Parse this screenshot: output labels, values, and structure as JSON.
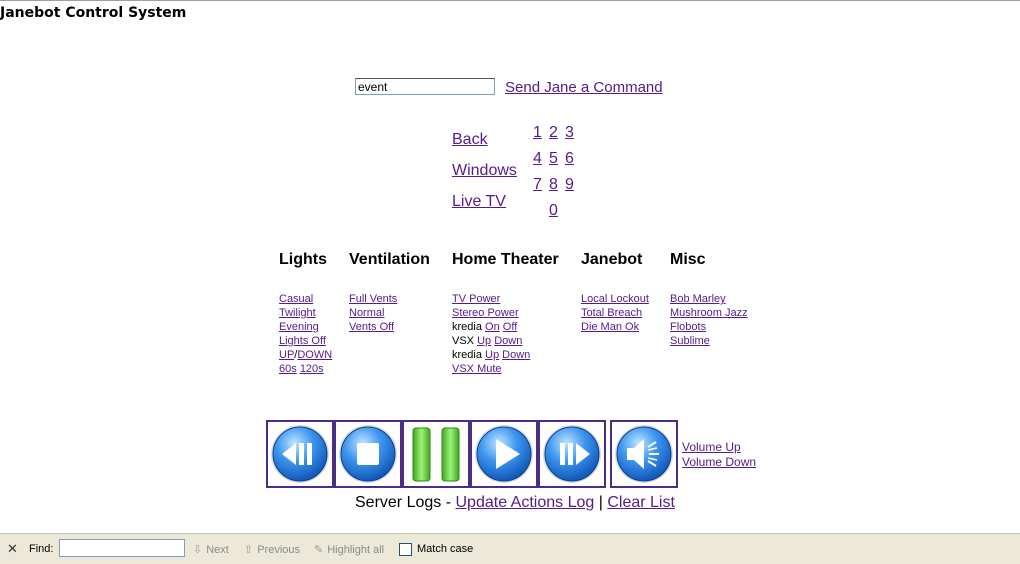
{
  "header": {
    "title": "Janebot Control System"
  },
  "command": {
    "input_value": "event",
    "send_label": "Send Jane a Command"
  },
  "nav": {
    "back": "Back",
    "windows": "Windows",
    "live_tv": "Live TV"
  },
  "keypad": [
    "1",
    "2",
    "3",
    "4",
    "5",
    "6",
    "7",
    "8",
    "9",
    "0"
  ],
  "columns": {
    "lights": {
      "heading": "Lights",
      "items": [
        "Casual",
        "Twilight",
        "Evening",
        "Lights Off"
      ],
      "updown_up": "UP",
      "updown_sep": "/",
      "updown_down": "DOWN",
      "timer_60": "60s",
      "timer_120": "120s"
    },
    "ventilation": {
      "heading": "Ventilation",
      "items": [
        "Full Vents",
        "Normal",
        "Vents Off"
      ]
    },
    "home_theater": {
      "heading": "Home Theater",
      "tv_power": "TV Power",
      "stereo_power": "Stereo Power",
      "kredia1_label": "kredia",
      "kredia1_on": "On",
      "kredia1_off": "Off",
      "vsx_label": "VSX",
      "vsx_up": "Up",
      "vsx_down": "Down",
      "kredia2_label": "kredia",
      "kredia2_up": "Up",
      "kredia2_down": "Down",
      "vsx_mute": "VSX Mute"
    },
    "janebot": {
      "heading": "Janebot",
      "items": [
        "Local Lockout",
        "Total Breach",
        "Die Man Ok"
      ]
    },
    "misc": {
      "heading": "Misc",
      "items": [
        "Bob Marley",
        "Mushroom Jazz",
        "Flobots",
        "Sublime"
      ]
    }
  },
  "media": {
    "buttons": [
      "rewind-icon",
      "stop-icon",
      "pause-icon",
      "play-icon",
      "fast-forward-icon",
      "speaker-icon"
    ],
    "volume_up": "Volume Up",
    "volume_down": "Volume Down"
  },
  "logs": {
    "prefix": "Server Logs -",
    "update": "Update Actions Log",
    "sep": "|",
    "clear": "Clear List"
  },
  "findbar": {
    "close": "✕",
    "find_label": "Find:",
    "next": "Next",
    "previous": "Previous",
    "highlight_all": "Highlight all",
    "match_case": "Match case",
    "match_case_checked": false
  },
  "colors": {
    "link": "#551a8b",
    "button_border": "#4b2e83",
    "media_blue": "#1e7be0",
    "pause_green": "#5cc23a",
    "findbar_bg": "#ece9d8"
  }
}
